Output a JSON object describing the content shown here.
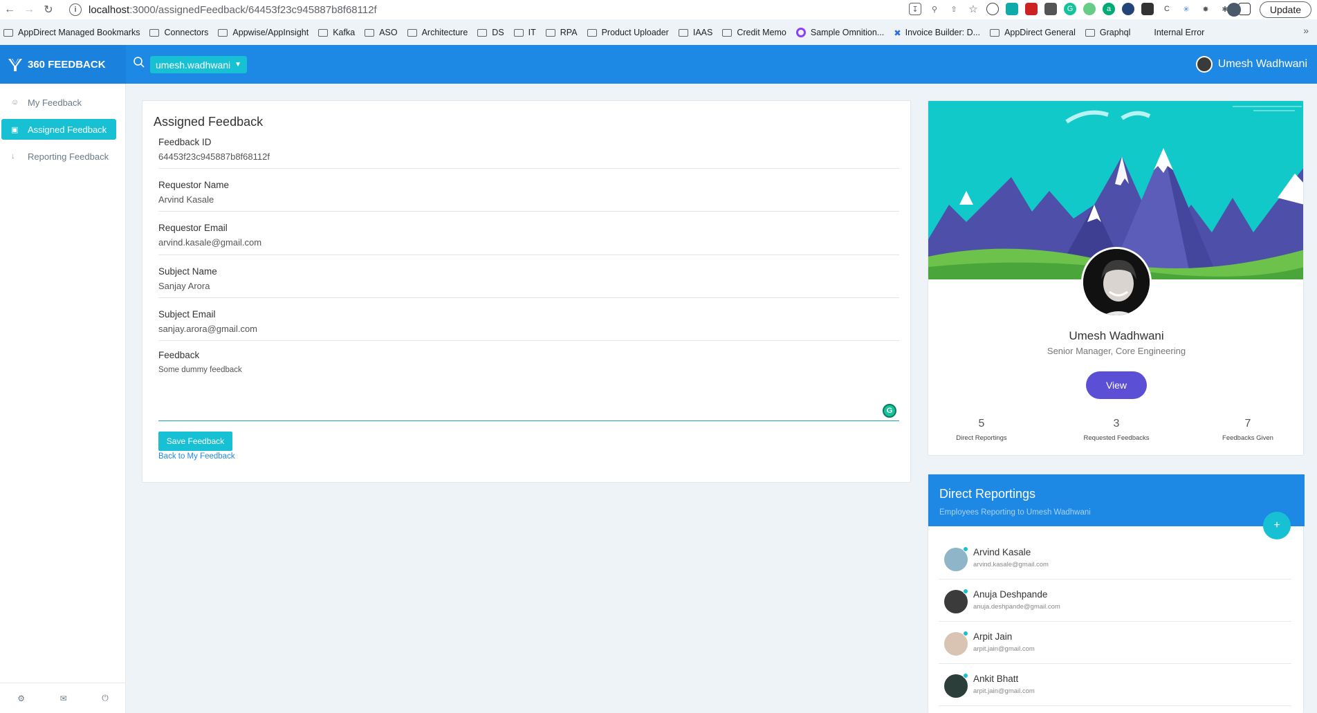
{
  "browser": {
    "url_host": "localhost",
    "url_path": ":3000/assignedFeedback/64453f23c945887b8f68112f",
    "update_label": "Update",
    "bookmarks": [
      "AppDirect Managed Bookmarks",
      "Connectors",
      "Appwise/AppInsight",
      "Kafka",
      "ASO",
      "Architecture",
      "DS",
      "IT",
      "RPA",
      "Product Uploader",
      "IAAS",
      "Credit Memo",
      "Sample Omnition...",
      "Invoice Builder: D...",
      "AppDirect General",
      "Graphql",
      "Internal Error"
    ],
    "more": "»"
  },
  "header": {
    "brand": "360 FEEDBACK",
    "user_select": "umesh.wadhwani",
    "user_name": "Umesh Wadhwani"
  },
  "sidebar": {
    "items": [
      {
        "label": "My Feedback",
        "icon": "users-icon"
      },
      {
        "label": "Assigned Feedback",
        "icon": "clipboard-icon"
      },
      {
        "label": "Reporting Feedback",
        "icon": "arrow-down-icon"
      }
    ]
  },
  "form": {
    "title": "Assigned Feedback",
    "fields": [
      {
        "label": "Feedback ID",
        "value": "64453f23c945887b8f68112f"
      },
      {
        "label": "Requestor Name",
        "value": "Arvind Kasale"
      },
      {
        "label": "Requestor Email",
        "value": "arvind.kasale@gmail.com"
      },
      {
        "label": "Subject Name",
        "value": "Sanjay Arora"
      },
      {
        "label": "Subject Email",
        "value": "sanjay.arora@gmail.com"
      }
    ],
    "feedback_label": "Feedback",
    "feedback_value": "Some dummy feedback",
    "save_label": "Save Feedback",
    "back_label": "Back to My Feedback"
  },
  "profile": {
    "name": "Umesh Wadhwani",
    "role": "Senior Manager, Core Engineering",
    "view_label": "View",
    "stats": [
      {
        "value": "5",
        "label": "Direct Reportings"
      },
      {
        "value": "3",
        "label": "Requested Feedbacks"
      },
      {
        "value": "7",
        "label": "Feedbacks Given"
      }
    ]
  },
  "direct_reportings": {
    "title": "Direct Reportings",
    "subtitle": "Employees Reporting to Umesh Wadhwani",
    "add_label": "+",
    "items": [
      {
        "name": "Arvind Kasale",
        "email": "arvind.kasale@gmail.com",
        "color": "#8fb5c9"
      },
      {
        "name": "Anuja Deshpande",
        "email": "anuja.deshpande@gmail.com",
        "color": "#3b3b3b"
      },
      {
        "name": "Arpit Jain",
        "email": "arpit.jain@gmail.com",
        "color": "#d9c3b2"
      },
      {
        "name": "Ankit Bhatt",
        "email": "arpit.jain@gmail.com",
        "color": "#2c3e3a"
      }
    ]
  },
  "colors": {
    "header_blue": "#1e88e5",
    "accent_cyan": "#17c1d3",
    "view_purple": "#5b4fd6"
  }
}
